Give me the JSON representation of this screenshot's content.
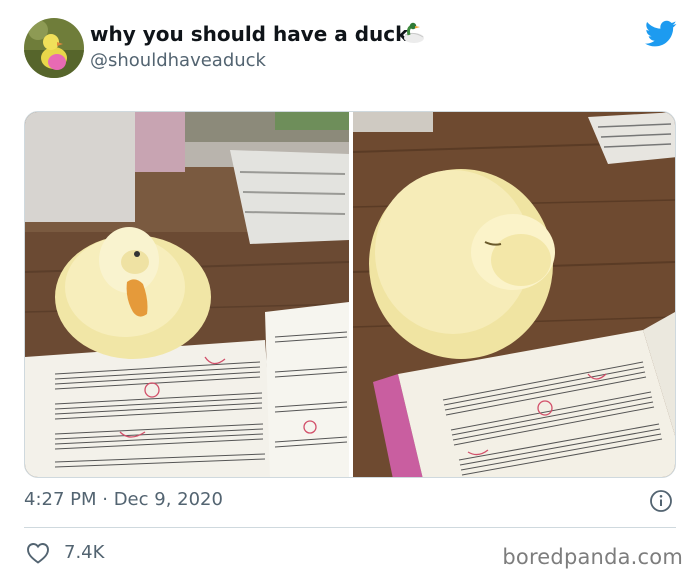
{
  "author": {
    "display_name": "why you should have a duck",
    "handle": "@shouldhaveaduck",
    "avatar": "avatar-duckling-photo",
    "name_emoji": "duck-emoji"
  },
  "header": {
    "logo": "twitter-bird-icon",
    "brand_color": "#1d9bf0"
  },
  "media": {
    "photos": [
      {
        "subject": "duck-on-sheet-music-photo-1"
      },
      {
        "subject": "duck-on-sheet-music-photo-2"
      }
    ]
  },
  "meta": {
    "timestamp": "4:27 PM · Dec 9, 2020",
    "info_icon": "info-icon"
  },
  "footer": {
    "like_icon": "heart-icon",
    "like_count": "7.4K",
    "watermark": "boredpanda.com"
  }
}
